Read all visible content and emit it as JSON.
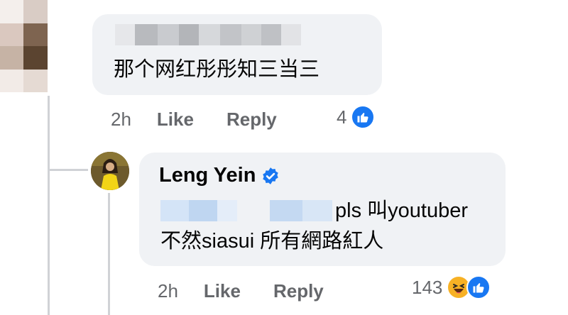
{
  "comment": {
    "text": "那个网红彤彤知三当三",
    "time": "2h",
    "like_label": "Like",
    "reply_label": "Reply",
    "reaction_count": "4",
    "reactions": [
      "like-icon"
    ]
  },
  "reply": {
    "author": "Leng Yein",
    "author_verified": true,
    "text_line1": "pls 叫youtuber",
    "text_line2": "不然siasui 所有網路紅人",
    "time": "2h",
    "like_label": "Like",
    "reply_label": "Reply",
    "reaction_count": "143",
    "reactions": [
      "haha-icon",
      "like-icon"
    ]
  },
  "colors": {
    "bubble_bg": "#f0f2f5",
    "meta_text": "#65676b",
    "like_blue": "#1877f2",
    "haha_yellow": "#f7b125",
    "thread_line": "#d0d2d6"
  }
}
